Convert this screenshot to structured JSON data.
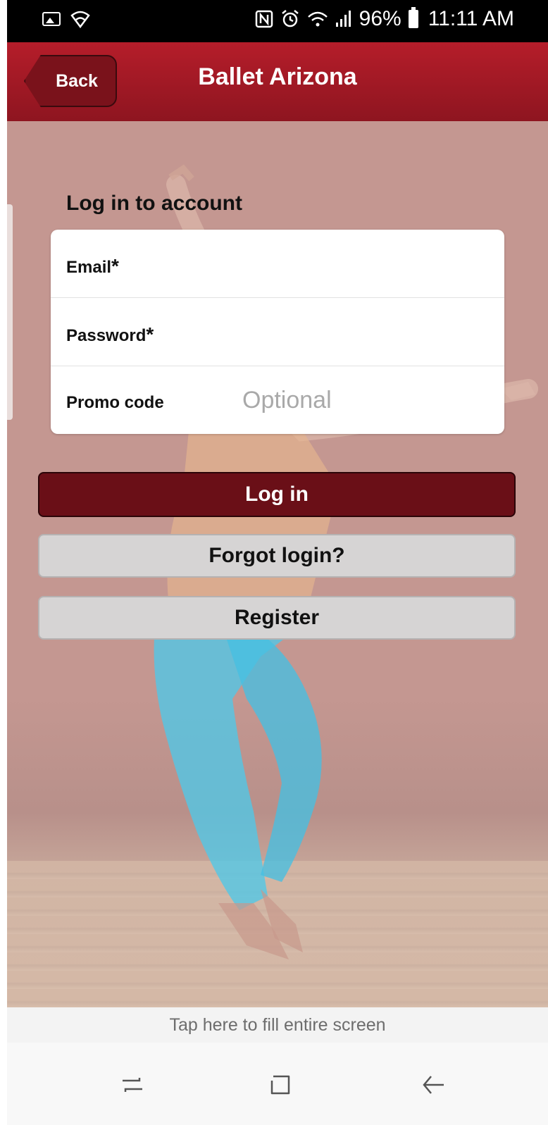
{
  "status_bar": {
    "battery": "96%",
    "time": "11:11 AM",
    "icons": [
      "image-icon",
      "wifi-icon",
      "nfc-icon",
      "alarm-icon",
      "wifi-call-icon",
      "signal-icon",
      "battery-icon"
    ]
  },
  "header": {
    "back_label": "Back",
    "title": "Ballet Arizona",
    "accent_color": "#a8192a"
  },
  "form": {
    "title": "Log in to account",
    "fields": [
      {
        "label": "Email",
        "required_mark": "*",
        "value": "",
        "placeholder": ""
      },
      {
        "label": "Password",
        "required_mark": "*",
        "value": "",
        "placeholder": ""
      },
      {
        "label": "Promo code",
        "required_mark": "",
        "value": "",
        "placeholder": "Optional"
      }
    ]
  },
  "buttons": {
    "login": "Log in",
    "forgot": "Forgot login?",
    "register": "Register"
  },
  "footer": {
    "fill_screen_text": "Tap here to fill entire screen"
  },
  "nav_bar": {
    "icons": [
      "recent-apps-icon",
      "home-icon",
      "back-arrow-icon"
    ]
  }
}
